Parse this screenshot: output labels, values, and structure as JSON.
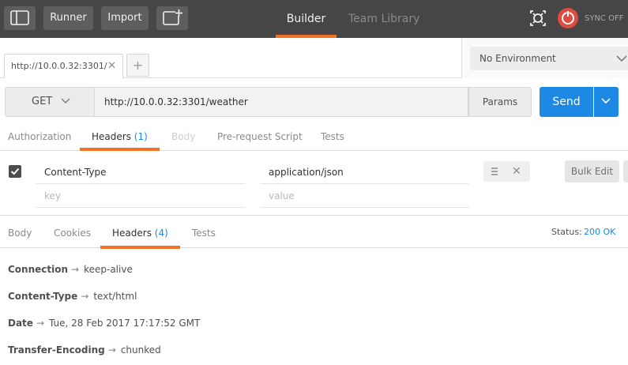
{
  "topbar": {
    "runner_label": "Runner",
    "import_label": "Import",
    "builder_label": "Builder",
    "library_label": "Team Library",
    "sync_label": "SYNC OFF",
    "accent_color": "#f47023"
  },
  "tabs": {
    "active_tab_label": "http://10.0.0.32:3301/",
    "close_glyph": "✕",
    "add_glyph": "+"
  },
  "environment": {
    "selected": "No Environment"
  },
  "request": {
    "method": "GET",
    "url": "http://10.0.0.32:3301/weather",
    "params_label": "Params",
    "send_label": "Send",
    "send_color": "#1e88e5"
  },
  "request_tabs": {
    "authorization": "Authorization",
    "headers": "Headers",
    "headers_count": "(1)",
    "body": "Body",
    "prerequest": "Pre-request Script",
    "tests": "Tests"
  },
  "header_editor": {
    "rows": [
      {
        "key": "Content-Type",
        "value": "application/json",
        "checked": true
      }
    ],
    "key_placeholder": "key",
    "value_placeholder": "value",
    "bulk_edit_label": "Bulk Edit",
    "remove_glyph": "✕"
  },
  "response_tabs": {
    "body": "Body",
    "cookies": "Cookies",
    "headers": "Headers",
    "headers_count": "(4)",
    "tests": "Tests",
    "status_label": "Status:",
    "status_value": "200 OK"
  },
  "response_headers": [
    {
      "name": "Connection",
      "arrow": "→",
      "value": "keep-alive"
    },
    {
      "name": "Content-Type",
      "arrow": "→",
      "value": "text/html"
    },
    {
      "name": "Date",
      "arrow": "→",
      "value": "Tue, 28 Feb 2017 17:17:52 GMT"
    },
    {
      "name": "Transfer-Encoding",
      "arrow": "→",
      "value": "chunked"
    }
  ]
}
